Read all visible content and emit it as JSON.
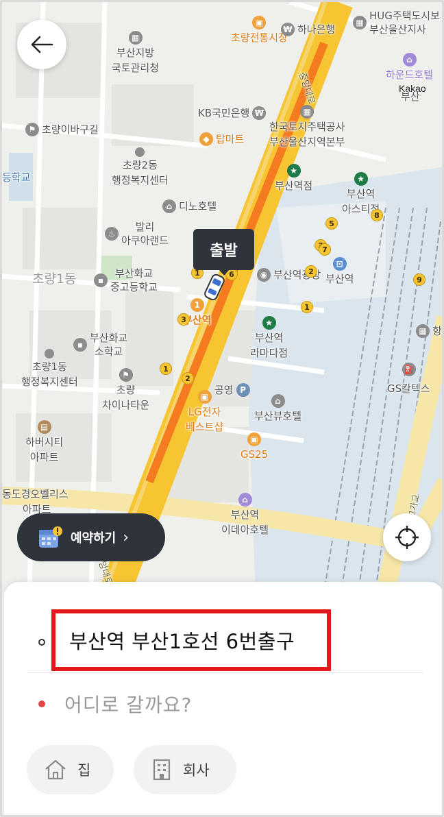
{
  "map": {
    "attribution": "Kakao",
    "depart_tag": "출발",
    "district_label": "초량1동",
    "road_labels": {
      "jungang": "중앙대로",
      "jungang_lower": "중앙대로",
      "yeongju": "영주고가교"
    },
    "places": {
      "choryang_market": "초량전통시장",
      "hana_bank": "하나은행",
      "hug_line1": "HUG주택도시보",
      "hug_line2": "부산울산지사",
      "busan_land_line1": "부산지방",
      "busan_land_line2": "국토관리청",
      "haeundae_hotel": "하운드호텔",
      "haeundae_hotel2": "부산",
      "kb_bank": "KB국민은행",
      "topmart": "탑마트",
      "choryang_street": "초량이바구길",
      "lh_line1": "한국토지주택공사",
      "lh_line2": "부산울산지역본부",
      "choryang2_line1": "초량2동",
      "choryang2_line2": "행정복지센터",
      "school_edge": "등학교",
      "starbucks_station": "부산역점",
      "starbucks_asti_line1": "부산역",
      "starbucks_asti_line2": "아스티점",
      "dino_hotel": "디노호텔",
      "bali_line1": "발리",
      "bali_line2": "아쿠아랜드",
      "station_plaza": "부산역광장",
      "busan_station_metro": "부산역",
      "busan_station_label": "부산역",
      "hwagyo_high_line1": "부산화교",
      "hwagyo_high_line2": "중고등학교",
      "hwagyo_elem_line1": "부산화교",
      "hwagyo_elem_line2": "소학교",
      "starbucks_rama_line1": "부산역",
      "starbucks_rama_line2": "라마다점",
      "choryang1_line1": "초량1동",
      "choryang1_line2": "행정복지센터",
      "chinatown_line1": "초량",
      "chinatown_line2": "차이나타운",
      "gongyeong_parking": "공영",
      "busan_view_hotel": "부산뷰호텔",
      "gs_caltex": "GS칼텍스",
      "hanbit_edge": "항",
      "harbor_city_line1": "하버시티",
      "harbor_city_line2": "아파트",
      "lg_shop_line1": "LG전자",
      "lg_shop_line2": "베스트샵",
      "gs25": "GS25",
      "kyungo_line1": "동도경오벨리스",
      "kyungo_line2": "아파트",
      "idea_hotel_line1": "부산역",
      "idea_hotel_line2": "이데아호텔"
    },
    "exits": [
      "5",
      "3",
      "7",
      "2",
      "1",
      "8",
      "9",
      "6",
      "3",
      "1",
      "2",
      "1"
    ]
  },
  "controls": {
    "back_icon": "arrow-left-icon",
    "reserve_label": "예약하기",
    "reserve_chevron": "›",
    "locate_icon": "crosshair-icon"
  },
  "trip": {
    "origin": "부산역 부산1호선 6번출구",
    "destination_placeholder": "어디로 갈까요?"
  },
  "shortcuts": [
    {
      "label": "집",
      "icon": "home-icon"
    },
    {
      "label": "회사",
      "icon": "building-icon"
    }
  ],
  "colors": {
    "highlight_box": "#e3191c",
    "main_road": "#f7c531",
    "route_line": "#f47b20",
    "button_dark": "#2f333b"
  }
}
